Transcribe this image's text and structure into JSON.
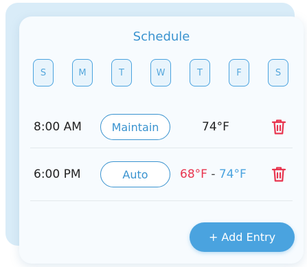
{
  "title": "Schedule",
  "days": [
    "S",
    "M",
    "T",
    "W",
    "T",
    "F",
    "S"
  ],
  "entries": [
    {
      "time": "8:00 AM",
      "mode": "Maintain",
      "temp": "74°F"
    },
    {
      "time": "6:00 PM",
      "mode": "Auto",
      "temp_low": "68°F",
      "temp_sep": "-",
      "temp_high": "74°F"
    }
  ],
  "add_button_label": "+ Add Entry",
  "icons": {
    "delete": "trash-icon"
  },
  "colors": {
    "accent": "#4aa3df",
    "title": "#3a93cf",
    "delete": "#e8344e",
    "low_temp": "#e8344e",
    "high_temp": "#4aa3df",
    "backdrop": "#d9ecf8"
  }
}
